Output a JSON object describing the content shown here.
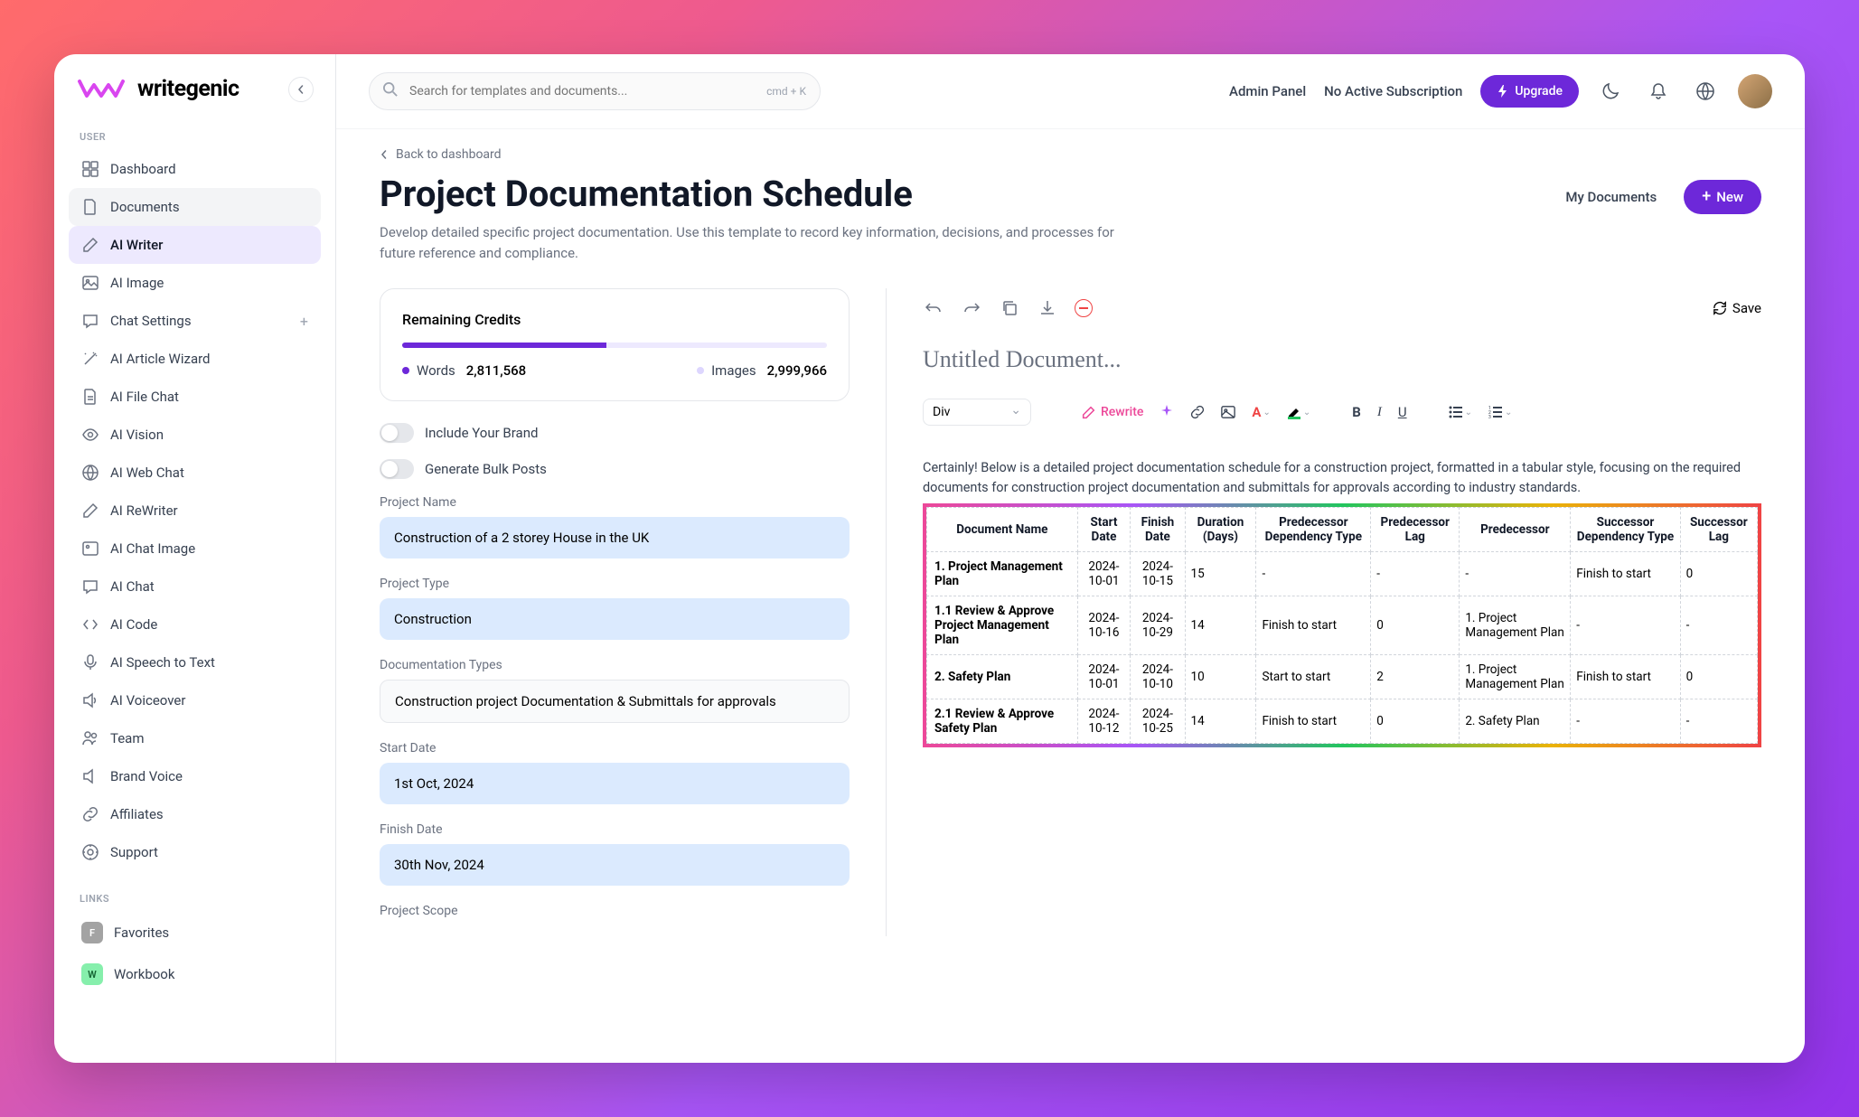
{
  "brand": {
    "name": "writegenic"
  },
  "sidebar": {
    "user_label": "USER",
    "links_label": "LINKS",
    "items": [
      {
        "label": "Dashboard"
      },
      {
        "label": "Documents"
      },
      {
        "label": "AI Writer"
      },
      {
        "label": "AI Image"
      },
      {
        "label": "Chat Settings"
      },
      {
        "label": "AI Article Wizard"
      },
      {
        "label": "AI File Chat"
      },
      {
        "label": "AI Vision"
      },
      {
        "label": "AI Web Chat"
      },
      {
        "label": "AI ReWriter"
      },
      {
        "label": "AI Chat Image"
      },
      {
        "label": "AI Chat"
      },
      {
        "label": "AI Code"
      },
      {
        "label": "AI Speech to Text"
      },
      {
        "label": "AI Voiceover"
      },
      {
        "label": "Team"
      },
      {
        "label": "Brand Voice"
      },
      {
        "label": "Affiliates"
      },
      {
        "label": "Support"
      }
    ],
    "links": [
      {
        "label": "Favorites",
        "badge": "F"
      },
      {
        "label": "Workbook",
        "badge": "W"
      }
    ]
  },
  "topbar": {
    "search_placeholder": "Search for templates and documents...",
    "search_kbd": "cmd  +  K",
    "admin_link": "Admin Panel",
    "subscription": "No Active Subscription",
    "upgrade": "Upgrade"
  },
  "page": {
    "back": "Back to dashboard",
    "title": "Project Documentation Schedule",
    "desc": "Develop detailed specific project documentation. Use this template to record key information, decisions, and processes for future reference and compliance.",
    "my_docs": "My Documents",
    "new": "New"
  },
  "credits": {
    "title": "Remaining Credits",
    "words_label": "Words",
    "words_value": "2,811,568",
    "images_label": "Images",
    "images_value": "2,999,966"
  },
  "form": {
    "brand_toggle": "Include Your Brand",
    "bulk_toggle": "Generate Bulk Posts",
    "project_name_label": "Project Name",
    "project_name_value": "Construction of a 2 storey House in the UK",
    "project_type_label": "Project Type",
    "project_type_value": "Construction",
    "doc_types_label": "Documentation Types",
    "doc_types_value": "Construction project Documentation & Submittals for approvals",
    "start_label": "Start Date",
    "start_value": "1st Oct, 2024",
    "finish_label": "Finish Date",
    "finish_value": "30th Nov, 2024",
    "scope_label": "Project Scope"
  },
  "editor": {
    "save": "Save",
    "title": "Untitled Document...",
    "format_select": "Div",
    "rewrite": "Rewrite",
    "intro": "Certainly! Below is a detailed project documentation schedule for a construction project, formatted in a tabular style, focusing on the required documents for construction project documentation and submittals for approvals according to industry standards."
  },
  "table": {
    "headers": [
      "Document Name",
      "Start Date",
      "Finish Date",
      "Duration (Days)",
      "Predecessor Dependency Type",
      "Predecessor Lag",
      "Predecessor",
      "Successor Dependency Type",
      "Successor Lag"
    ],
    "rows": [
      {
        "name": "1. Project Management Plan",
        "start": "2024-10-01",
        "finish": "2024-10-15",
        "dur": "15",
        "pdt": "-",
        "plag": "-",
        "pred": "-",
        "sdt": "Finish to start",
        "slag": "0"
      },
      {
        "name": "1.1 Review & Approve Project Management Plan",
        "start": "2024-10-16",
        "finish": "2024-10-29",
        "dur": "14",
        "pdt": "Finish to start",
        "plag": "0",
        "pred": "1. Project Management Plan",
        "sdt": "-",
        "slag": "-"
      },
      {
        "name": "2. Safety Plan",
        "start": "2024-10-01",
        "finish": "2024-10-10",
        "dur": "10",
        "pdt": "Start to start",
        "plag": "2",
        "pred": "1. Project Management Plan",
        "sdt": "Finish to start",
        "slag": "0"
      },
      {
        "name": "2.1 Review & Approve Safety Plan",
        "start": "2024-10-12",
        "finish": "2024-10-25",
        "dur": "14",
        "pdt": "Finish to start",
        "plag": "0",
        "pred": "2. Safety Plan",
        "sdt": "-",
        "slag": "-"
      }
    ]
  }
}
